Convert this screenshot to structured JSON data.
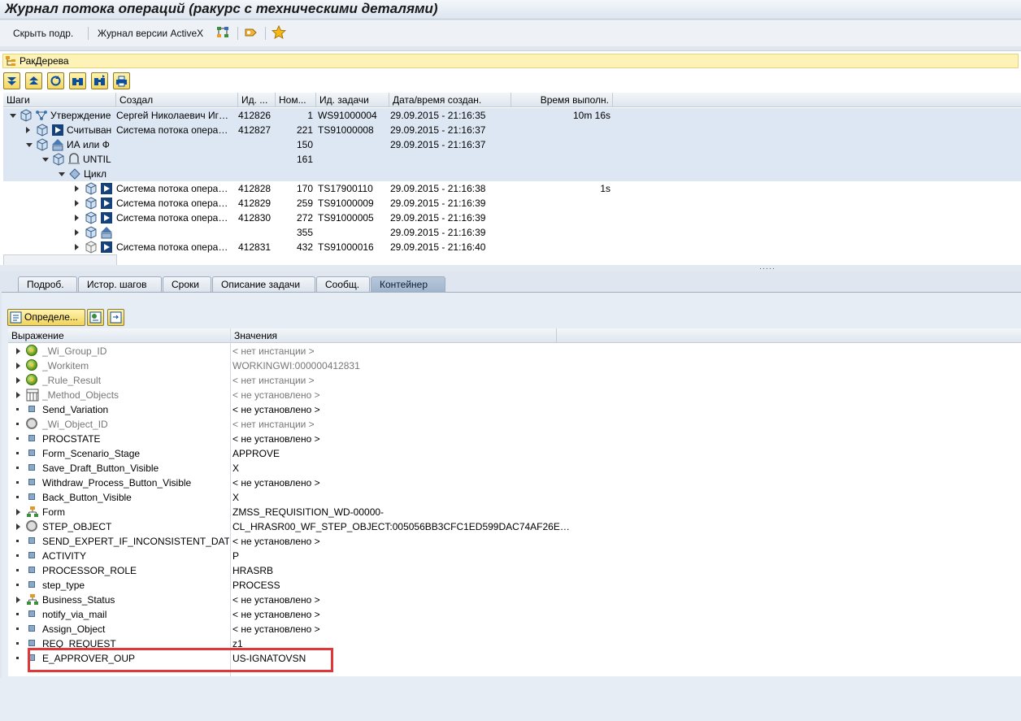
{
  "window": {
    "title": "Журнал потока операций (ракурс с техническими деталями)"
  },
  "toolbar": {
    "hide_details": "Скрыть подр.",
    "activex_log": "Журнал версии ActiveX"
  },
  "tree_panel": {
    "header": "РакДерева"
  },
  "steps": {
    "columns": [
      "Шаги",
      "Создал",
      "Ид. ...",
      "Ном...",
      "Ид. задачи",
      "Дата/время создан.",
      "Время выполн."
    ],
    "rows": [
      {
        "step": "Утверждение",
        "creator": "Сергей Николаевич Иг…",
        "id": "412826",
        "num": "1",
        "task": "WS91000004",
        "created": "29.09.2015 - 21:16:35",
        "duration": "10m 16s"
      },
      {
        "step": "Считыван",
        "creator": "Система потока опера…",
        "id": "412827",
        "num": "221",
        "task": "TS91000008",
        "created": "29.09.2015 - 21:16:37",
        "duration": ""
      },
      {
        "step": "ИА или Ф",
        "creator": "",
        "id": "",
        "num": "150",
        "task": "",
        "created": "29.09.2015 - 21:16:37",
        "duration": ""
      },
      {
        "step": "UNTIL",
        "creator": "",
        "id": "",
        "num": "161",
        "task": "",
        "created": "",
        "duration": ""
      },
      {
        "step": "Цикл",
        "creator": "",
        "id": "",
        "num": "",
        "task": "",
        "created": "",
        "duration": ""
      },
      {
        "step": "",
        "creator": "Система потока опера…",
        "id": "412828",
        "num": "170",
        "task": "TS17900110",
        "created": "29.09.2015 - 21:16:38",
        "duration": "1s"
      },
      {
        "step": "",
        "creator": "Система потока опера…",
        "id": "412829",
        "num": "259",
        "task": "TS91000009",
        "created": "29.09.2015 - 21:16:39",
        "duration": ""
      },
      {
        "step": "",
        "creator": "Система потока опера…",
        "id": "412830",
        "num": "272",
        "task": "TS91000005",
        "created": "29.09.2015 - 21:16:39",
        "duration": ""
      },
      {
        "step": "",
        "creator": "",
        "id": "",
        "num": "355",
        "task": "",
        "created": "29.09.2015 - 21:16:39",
        "duration": ""
      },
      {
        "step": "",
        "creator": "Система потока опера…",
        "id": "412831",
        "num": "432",
        "task": "TS91000016",
        "created": "29.09.2015 - 21:16:40",
        "duration": ""
      }
    ]
  },
  "tabs": [
    "Подроб.",
    "Истор. шагов",
    "Сроки",
    "Описание задачи",
    "Сообщ.",
    "Контейнер"
  ],
  "container": {
    "define_button": "Определе...",
    "columns": [
      "Выражение",
      "Значения"
    ],
    "rows": [
      {
        "name": "_Wi_Group_ID",
        "value": "< нет инстанции >"
      },
      {
        "name": "_Workitem",
        "value": "WORKINGWI:000000412831"
      },
      {
        "name": "_Rule_Result",
        "value": "< нет инстанции >"
      },
      {
        "name": "_Method_Objects",
        "value": "< не установлено >"
      },
      {
        "name": "Send_Variation",
        "value": "< не установлено >"
      },
      {
        "name": "_Wi_Object_ID",
        "value": "< нет инстанции >"
      },
      {
        "name": "PROCSTATE",
        "value": "< не установлено >"
      },
      {
        "name": "Form_Scenario_Stage",
        "value": "APPROVE"
      },
      {
        "name": "Save_Draft_Button_Visible",
        "value": "X"
      },
      {
        "name": "Withdraw_Process_Button_Visible",
        "value": "< не установлено >"
      },
      {
        "name": "Back_Button_Visible",
        "value": "X"
      },
      {
        "name": "Form",
        "value": "ZMSS_REQUISITION_WD-00000-"
      },
      {
        "name": "STEP_OBJECT",
        "value": "CL_HRASR00_WF_STEP_OBJECT:005056BB3CFC1ED599DAC74AF26E…"
      },
      {
        "name": "SEND_EXPERT_IF_INCONSISTENT_DATA",
        "value": "< не установлено >"
      },
      {
        "name": "ACTIVITY",
        "value": "P"
      },
      {
        "name": "PROCESSOR_ROLE",
        "value": "HRASRB"
      },
      {
        "name": "step_type",
        "value": "PROCESS"
      },
      {
        "name": "Business_Status",
        "value": "< не установлено >"
      },
      {
        "name": "notify_via_mail",
        "value": "< не установлено >"
      },
      {
        "name": "Assign_Object",
        "value": "< не установлено >"
      },
      {
        "name": "REQ_REQUEST",
        "value": "z1"
      },
      {
        "name": "E_APPROVER_OUP",
        "value": "US-IGNATOVSN"
      }
    ]
  },
  "colors": {
    "highlight": "#e03838",
    "selected_row": "#dde7f3",
    "header_yellow": "#fdf3b7"
  }
}
